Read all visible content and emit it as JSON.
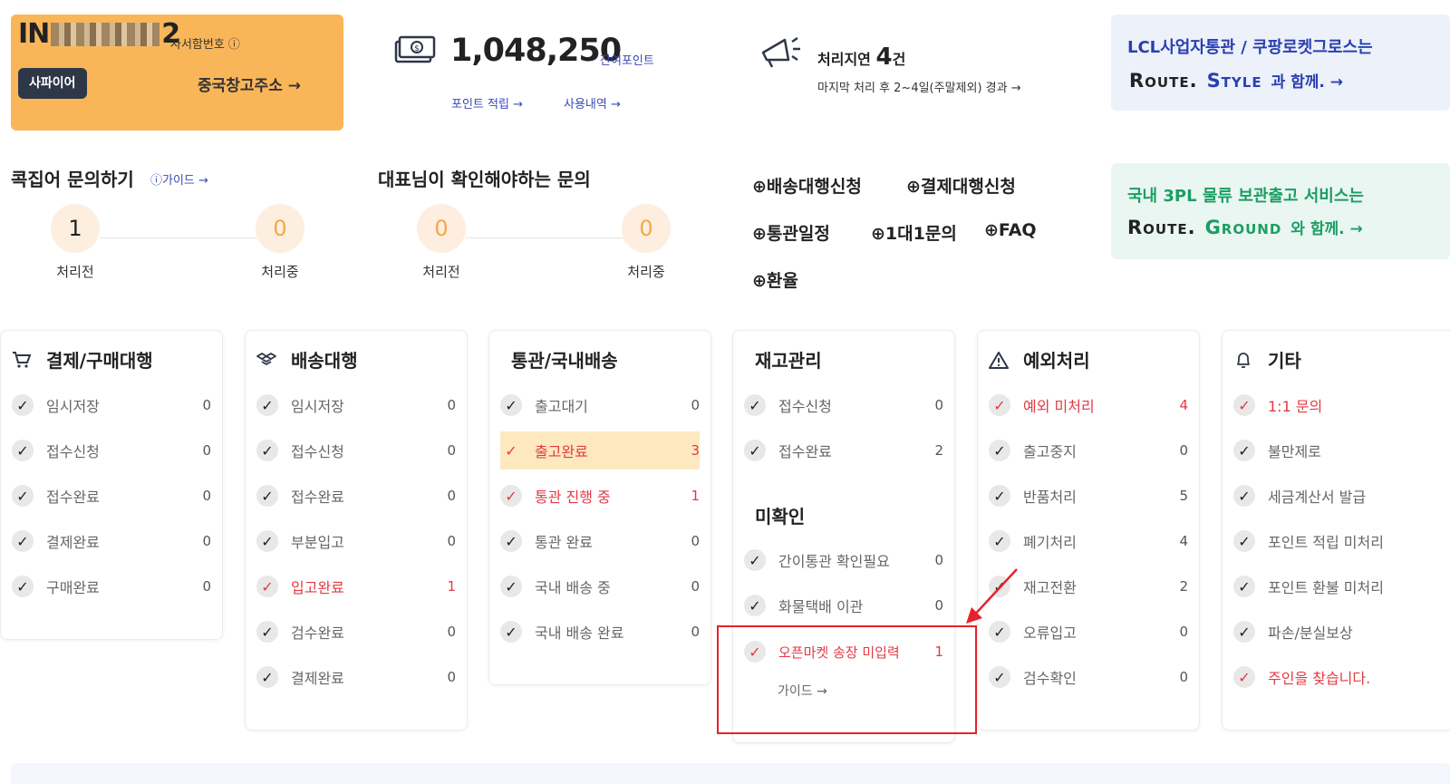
{
  "account": {
    "id_prefix": "IN",
    "id_suffix": "2",
    "id_sub_label": "사서함번호 ⓘ",
    "tier_badge": "사파이어",
    "cn_address_link": "중국창고주소 →"
  },
  "points": {
    "value": "1,048,250",
    "label": "잔여포인트",
    "earn_link": "포인트 적립 →",
    "history_link": "사용내역 →"
  },
  "delay": {
    "label": "처리지연",
    "count": "4",
    "unit": "건",
    "note": "마지막 처리 후 2~4일(주말제외) 경과 →"
  },
  "promo_lcl": {
    "line1": "LCL사업자통관 / 쿠팡로켓그로스는",
    "brand_a": "Route.",
    "brand_b": "Style",
    "tail": "과 함께. →"
  },
  "promo_3pl": {
    "line1": "국내 3PL 물류 보관출고 서비스는",
    "brand_a": "Route.",
    "brand_b": "Ground",
    "tail": "와 함께. →"
  },
  "inquiry_kz": {
    "title": "콕집어 문의하기",
    "guide": "ⓘ가이드 →",
    "before_count": "1",
    "before_label": "처리전",
    "during_count": "0",
    "during_label": "처리중"
  },
  "inquiry_ceo": {
    "title": "대표님이 확인해야하는 문의",
    "before_count": "0",
    "before_label": "처리전",
    "during_count": "0",
    "during_label": "처리중"
  },
  "quick_links": [
    "배송대행신청",
    "결제대행신청",
    "통관일정",
    "1대1문의",
    "FAQ",
    "환율"
  ],
  "cards": {
    "payment": {
      "title": "결제/구매대행",
      "rows": [
        {
          "label": "임시저장",
          "count": "0"
        },
        {
          "label": "접수신청",
          "count": "0"
        },
        {
          "label": "접수완료",
          "count": "0"
        },
        {
          "label": "결제완료",
          "count": "0"
        },
        {
          "label": "구매완료",
          "count": "0"
        }
      ]
    },
    "shipping": {
      "title": "배송대행",
      "rows": [
        {
          "label": "임시저장",
          "count": "0"
        },
        {
          "label": "접수신청",
          "count": "0"
        },
        {
          "label": "접수완료",
          "count": "0"
        },
        {
          "label": "부분입고",
          "count": "0"
        },
        {
          "label": "입고완료",
          "count": "1"
        },
        {
          "label": "검수완료",
          "count": "0"
        },
        {
          "label": "결제완료",
          "count": "0"
        }
      ]
    },
    "customs": {
      "title": "통관/국내배송",
      "rows": [
        {
          "label": "출고대기",
          "count": "0"
        },
        {
          "label": "출고완료",
          "count": "3"
        },
        {
          "label": "통관 진행 중",
          "count": "1"
        },
        {
          "label": "통관 완료",
          "count": "0"
        },
        {
          "label": "국내 배송 중",
          "count": "0"
        },
        {
          "label": "국내 배송 완료",
          "count": "0"
        }
      ]
    },
    "inventory": {
      "title": "재고관리",
      "rows": [
        {
          "label": "접수신청",
          "count": "0"
        },
        {
          "label": "접수완료",
          "count": "2"
        }
      ],
      "sub_title": "미확인",
      "sub_rows": [
        {
          "label": "간이통관 확인필요",
          "count": "0"
        },
        {
          "label": "화물택배 이관",
          "count": "0"
        },
        {
          "label": "오픈마켓 송장 미입력",
          "count": "1"
        }
      ],
      "guide": "가이드 →"
    },
    "exception": {
      "title": "예외처리",
      "rows": [
        {
          "label": "예외 미처리",
          "count": "4"
        },
        {
          "label": "출고중지",
          "count": "0"
        },
        {
          "label": "반품처리",
          "count": "5"
        },
        {
          "label": "폐기처리",
          "count": "4"
        },
        {
          "label": "재고전환",
          "count": "2"
        },
        {
          "label": "오류입고",
          "count": "0"
        },
        {
          "label": "검수확인",
          "count": "0"
        }
      ]
    },
    "etc": {
      "title": "기타",
      "rows": [
        {
          "label": "1:1 문의"
        },
        {
          "label": "불만제로"
        },
        {
          "label": "세금계산서 발급"
        },
        {
          "label": "포인트 적립 미처리"
        },
        {
          "label": "포인트 환불 미처리"
        },
        {
          "label": "파손/분실보상"
        },
        {
          "label": "주인을 찾습니다."
        }
      ]
    }
  },
  "colors": {
    "orange_card": "#f9b659",
    "link_blue": "#3848b8",
    "alert_red": "#e23a44",
    "highlight": "#fde8bf",
    "annotation_red": "#e5232b"
  }
}
